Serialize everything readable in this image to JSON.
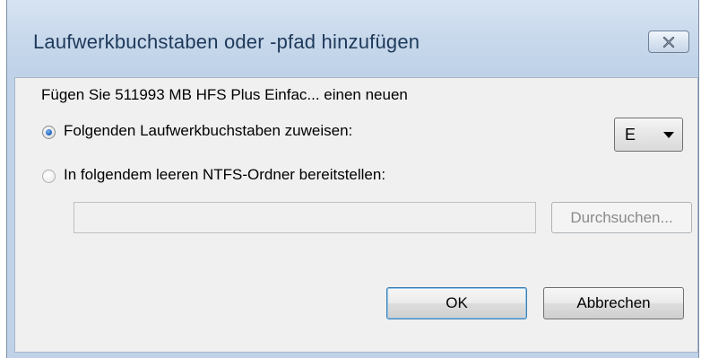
{
  "dialog": {
    "title": "Laufwerkbuchstaben oder -pfad hinzufügen",
    "close_icon": "close-icon",
    "description": "Fügen Sie 511993 MB HFS Plus Einfac... einen neuen",
    "options": [
      {
        "label": "Folgenden Laufwerkbuchstaben zuweisen:",
        "checked": true
      },
      {
        "label": "In folgendem leeren NTFS-Ordner bereitstellen:",
        "checked": false
      }
    ],
    "drive_letter": {
      "selected": "E"
    },
    "folder_path": {
      "value": ""
    },
    "buttons": {
      "browse": "Durchsuchen...",
      "ok": "OK",
      "cancel": "Abbrechen"
    }
  },
  "colors": {
    "title_text": "#1e3a5a",
    "frame": "#c4d6ea",
    "client_bg": "#f0f0f0",
    "radio_selected": "#2a6fc9"
  }
}
